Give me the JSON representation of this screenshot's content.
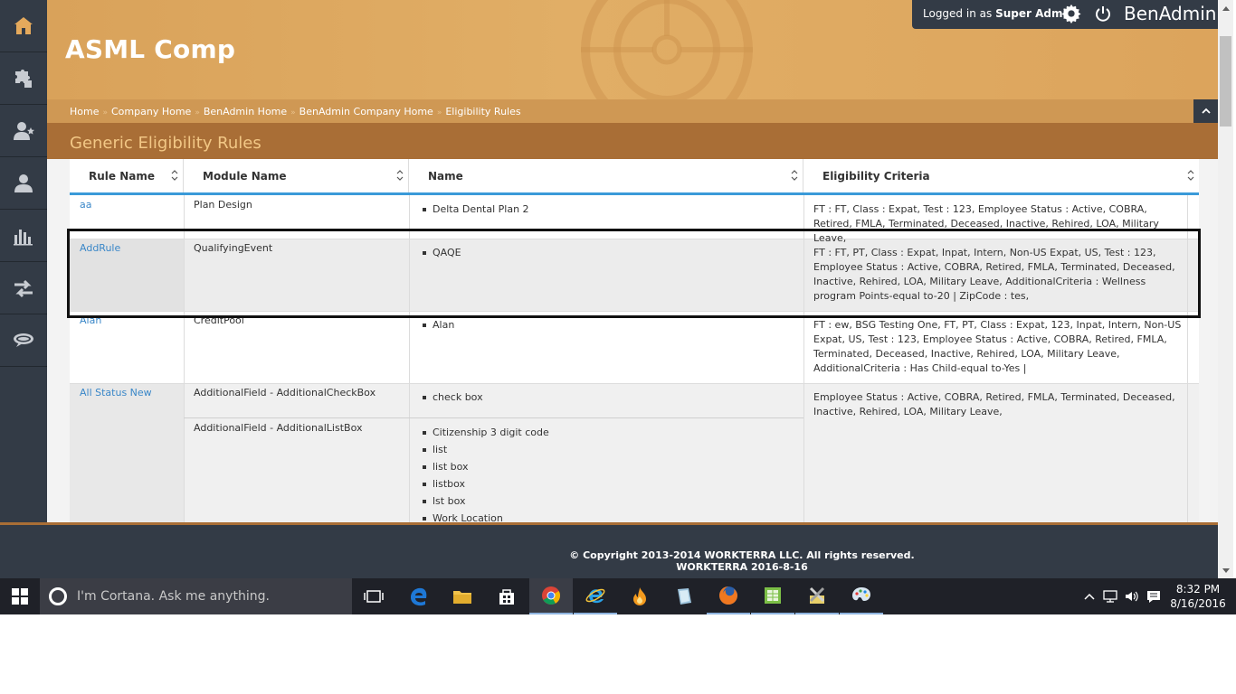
{
  "header": {
    "company_title": "ASML Comp",
    "login_prefix": "Logged in as",
    "login_user": "Super Admin",
    "brand": "BenAdmin"
  },
  "breadcrumb": [
    "Home",
    "Company Home",
    "BenAdmin Home",
    "BenAdmin Company Home",
    "Eligibility Rules"
  ],
  "breadcrumb_separator": "»",
  "section": {
    "title": "Generic Eligibility Rules"
  },
  "table": {
    "columns": [
      "Rule Name",
      "Module Name",
      "Name",
      "Eligibility Criteria"
    ],
    "rows": [
      {
        "rule_name": "aa",
        "module_name": "Plan Design",
        "names": [
          "Delta Dental Plan 2"
        ],
        "criteria": "FT : FT, Class : Expat, Test : 123, Employee Status : Active, COBRA, Retired, FMLA, Terminated, Deceased, Inactive, Rehired, LOA, Military Leave,"
      },
      {
        "rule_name": "AddRule",
        "module_name": "QualifyingEvent",
        "names": [
          "QAQE"
        ],
        "criteria": "FT : FT, PT, Class : Expat, Inpat, Intern, Non-US Expat, US, Test : 123, Employee Status : Active, COBRA, Retired, FMLA, Terminated, Deceased, Inactive, Rehired, LOA, Military Leave, AdditionalCriteria : Wellness program Points-equal to-20 | ZipCode : tes,"
      },
      {
        "rule_name": "Alan",
        "module_name": "CreditPool",
        "names": [
          "Alan"
        ],
        "criteria": "FT : ew, BSG Testing One, FT, PT, Class : Expat, 123, Inpat, Intern, Non-US Expat, US, Test : 123, Employee Status : Active, COBRA, Retired, FMLA, Terminated, Deceased, Inactive, Rehired, LOA, Military Leave, AdditionalCriteria : Has Child-equal to-Yes |"
      },
      {
        "rule_name": "All Status New",
        "module_name_1": "AdditionalField - AdditionalCheckBox",
        "names_1": [
          "check box"
        ],
        "module_name_2": "AdditionalField - AdditionalListBox",
        "names_2": [
          "Citizenship 3 digit code",
          "list",
          "list box",
          "listbox",
          "lst box",
          "Work Location"
        ],
        "criteria": "Employee Status : Active, COBRA, Retired, FMLA, Terminated, Deceased, Inactive, Rehired, LOA, Military Leave,"
      }
    ]
  },
  "footer": {
    "copyright": "© Copyright 2013-2014 WORKTERRA LLC. All rights reserved.",
    "version": "WORKTERRA 2016-8-16"
  },
  "taskbar": {
    "search_placeholder": "I'm Cortana. Ask me anything.",
    "time": "8:32 PM",
    "date": "8/16/2016"
  },
  "colors": {
    "sidebar": "#333b46",
    "header_gold": "#dca45c",
    "section_brown": "#a96e36",
    "link_blue": "#3a87c8",
    "header_underline": "#3a9ad9"
  }
}
